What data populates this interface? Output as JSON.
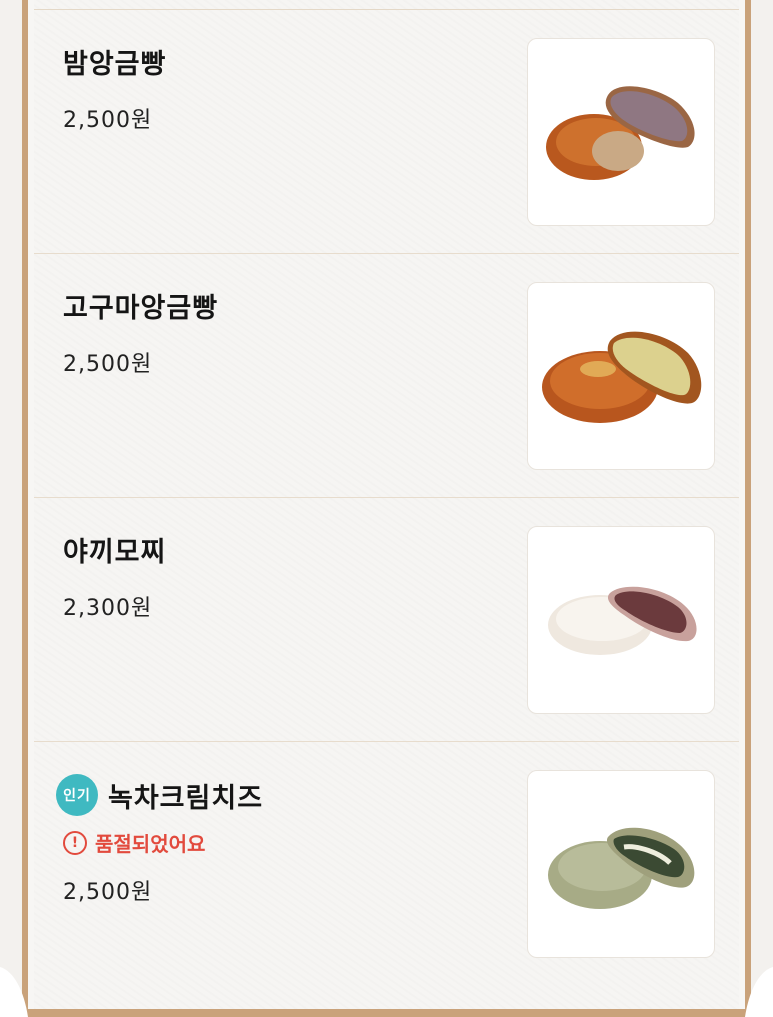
{
  "items": [
    {
      "name": "밤앙금빵",
      "price": "2,500원",
      "badge": "",
      "status": ""
    },
    {
      "name": "고구마앙금빵",
      "price": "2,500원",
      "badge": "",
      "status": ""
    },
    {
      "name": "야끼모찌",
      "price": "2,300원",
      "badge": "",
      "status": ""
    },
    {
      "name": "녹차크림치즈",
      "price": "2,500원",
      "badge": "인기",
      "status": "품절되었어요"
    }
  ],
  "colors": {
    "frame": "#c9a27a",
    "badge": "#3fb9c1",
    "soldout": "#e24a3d"
  },
  "icons": {
    "soldout": "exclamation-circle-icon"
  }
}
